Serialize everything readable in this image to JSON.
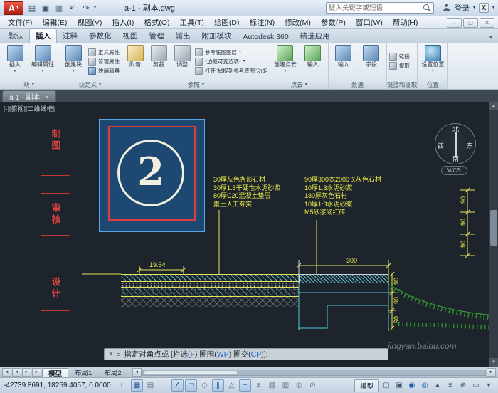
{
  "titlebar": {
    "logo_letter": "A",
    "doc_title": "a-1 - 副本.dwg",
    "search_placeholder": "键入关键字或短语",
    "login": "登录",
    "exchange": "X",
    "qat_icons": [
      "▤",
      "▣",
      "▥",
      "↶",
      "↷"
    ]
  },
  "menubar": {
    "items": [
      "文件(F)",
      "编辑(E)",
      "视图(V)",
      "插入(I)",
      "格式(O)",
      "工具(T)",
      "绘图(D)",
      "标注(N)",
      "修改(M)",
      "参数(P)",
      "窗口(W)",
      "帮助(H)"
    ]
  },
  "window_buttons": {
    "minimize": "–",
    "maximize": "□",
    "close": "×"
  },
  "ribbon": {
    "tabs": [
      "默认",
      "插入",
      "注释",
      "参数化",
      "视图",
      "管理",
      "输出",
      "附加模块",
      "Autodesk 360",
      "精选应用"
    ],
    "block": {
      "title": "块",
      "insert": "插入",
      "edit_attr": "编辑属性"
    },
    "block_def": {
      "title": "块定义",
      "create": "创建块",
      "def_attr": "定义属性",
      "manage_attr": "管理属性",
      "editor": "块编辑器"
    },
    "reference": {
      "title": "参照",
      "attach": "附着",
      "clip": "剪裁",
      "adjust": "调整",
      "underlay_layers": "参考底图图层",
      "frames": "*边框可变选项*",
      "snap": "打开\"捕捉到参考底图\"功能"
    },
    "point_cloud": {
      "title": "点云",
      "create": "创建点云",
      "import": "输入"
    },
    "data": {
      "title": "数据",
      "import": "输入",
      "field": "字段"
    },
    "linking": {
      "title": "链接和提取",
      "link": "链接",
      "extract": "提取"
    },
    "location": {
      "title": "位置",
      "set_location": "设置位置"
    }
  },
  "doc_tab": {
    "label": "a-1 - 副本",
    "close": "×"
  },
  "canvas": {
    "viewport_label": "[-][俯视][二维线框]",
    "titleblock": [
      "制图",
      "审核",
      "设计"
    ],
    "detail_number": "2",
    "notes_left": [
      "30厚灰色条形石材",
      "30厚1:3干硬性水泥砂浆",
      "80厚C20混凝土垫层",
      "素土人工夯实"
    ],
    "notes_right": [
      "90厚300宽2000长灰色石材",
      "10厚1:3水泥砂浆",
      "180厚灰色石材",
      "10厚1:3水泥砂浆",
      "M5砂浆砌红砖"
    ],
    "dim_width": "19.54",
    "dim_300": "300",
    "dim_90": "90",
    "compass": {
      "north": "北",
      "south": "南",
      "east": "东",
      "west": "西",
      "wcs": "WCS"
    },
    "watermark": "jingyan.baidu.com"
  },
  "command": {
    "close": "×",
    "customize": "≡",
    "pre": "指定对角点或 [栏选(",
    "opt_f": "F",
    "mid1": ") 圈围(",
    "opt_wp": "WP",
    "mid2": ") 圈交(",
    "opt_cp": "CP",
    "end": ")]:"
  },
  "layout_tabs": {
    "model": "模型",
    "layout1": "布局1",
    "layout2": "布局2"
  },
  "statusbar": {
    "coords": "-42739.8691, 18259.4057, 0.0000",
    "toggle_glyphs": [
      "∟",
      "▦",
      "▤",
      "⊥",
      "∠",
      "□",
      "◇",
      "∥",
      "△",
      "+",
      "≡",
      "▨",
      "▥",
      "◎",
      "⊙"
    ],
    "model_button": "模型",
    "right_glyphs": [
      "▢",
      "▣",
      "◉",
      "◎",
      "▲",
      "≡",
      "⊕",
      "▭",
      "▾"
    ]
  },
  "colors": {
    "canvas_bg": "#1d242b",
    "annotation_yellow": "#eef04a",
    "line_cyan": "#55c8da",
    "titleblock_red": "#da4242",
    "image_panel_blue": "#1d4872"
  }
}
